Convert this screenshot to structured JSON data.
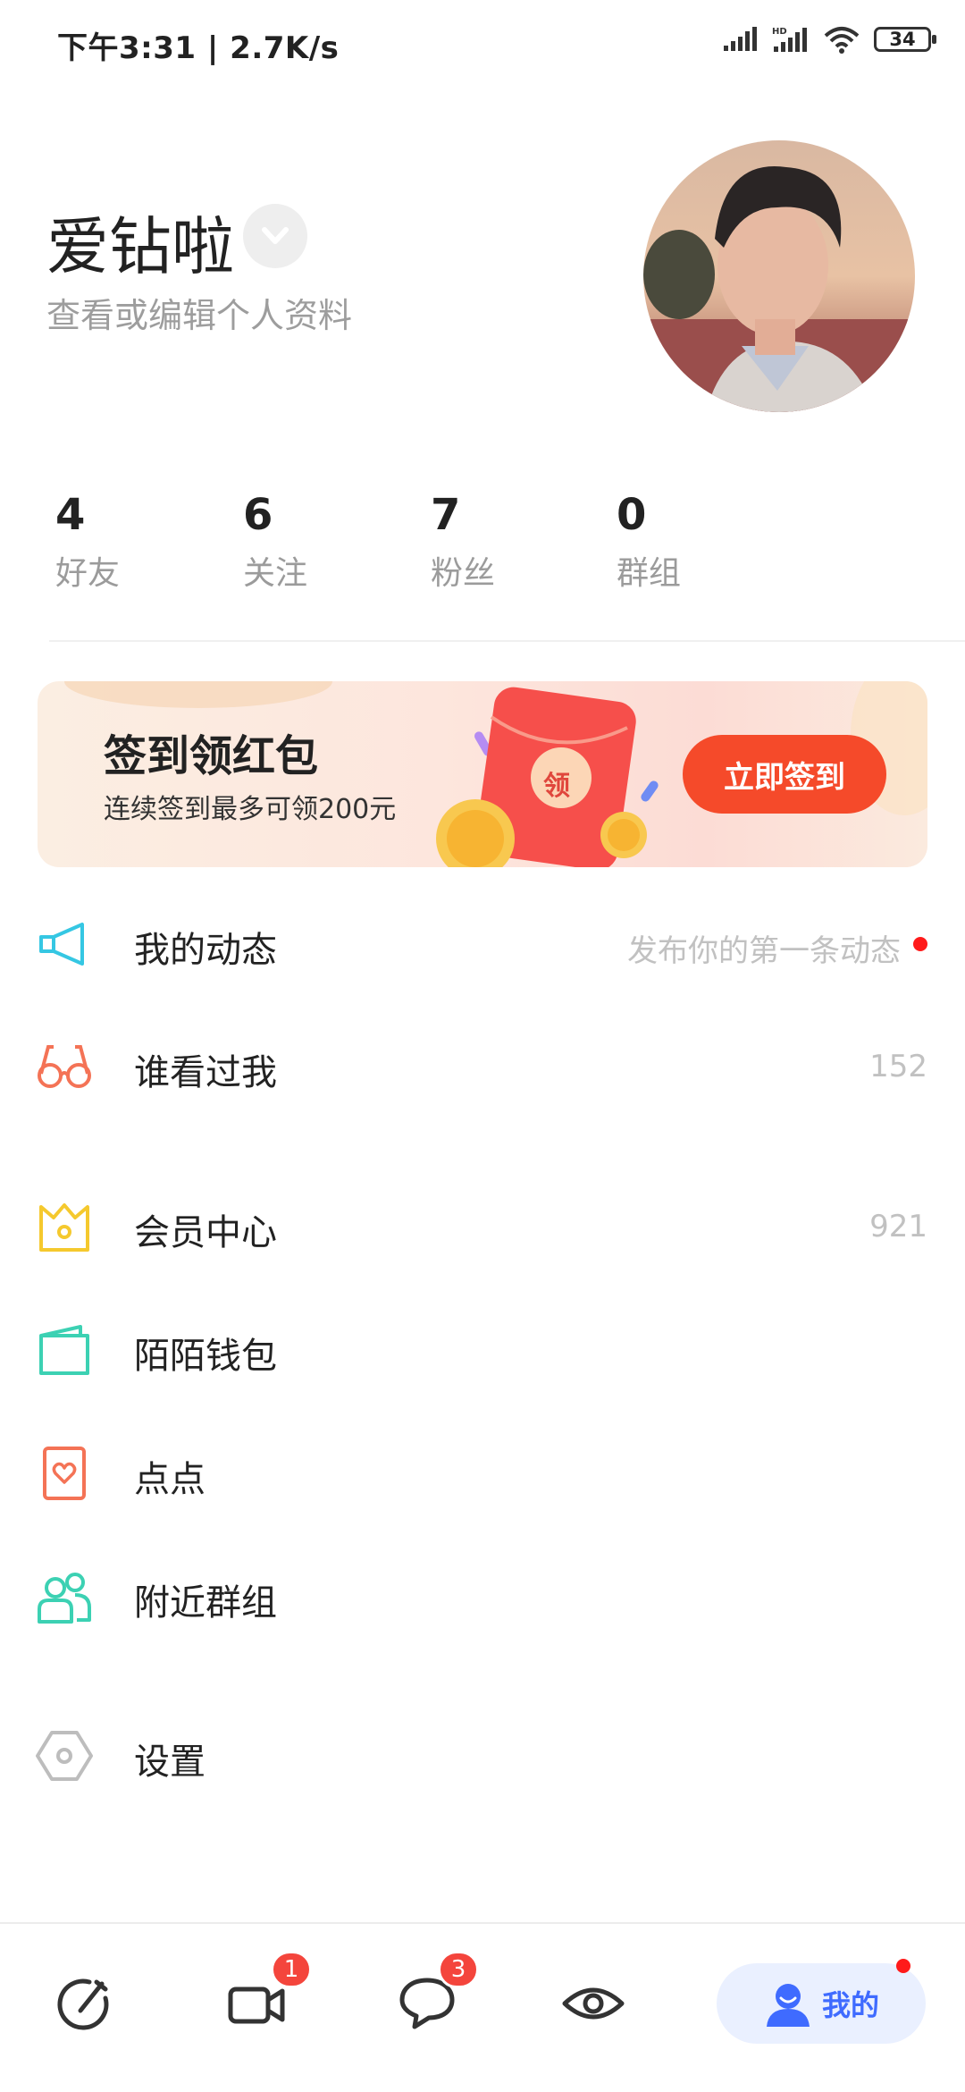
{
  "status_bar": {
    "time": "下午3:31 | 2.7K/s",
    "battery": "34"
  },
  "profile": {
    "name": "爱钻啦",
    "subtitle": "查看或编辑个人资料"
  },
  "stats": [
    {
      "value": "4",
      "label": "好友"
    },
    {
      "value": "6",
      "label": "关注"
    },
    {
      "value": "7",
      "label": "粉丝"
    },
    {
      "value": "0",
      "label": "群组"
    }
  ],
  "banner": {
    "title": "签到领红包",
    "subtitle": "连续签到最多可领200元",
    "button": "立即签到",
    "envelope_text": "领"
  },
  "menu": [
    {
      "label": "我的动态",
      "right": "发布你的第一条动态"
    },
    {
      "label": "谁看过我",
      "right": "152"
    },
    {
      "label": "会员中心",
      "right": "921"
    },
    {
      "label": "陌陌钱包"
    },
    {
      "label": "点点"
    },
    {
      "label": "附近群组"
    },
    {
      "label": "设置"
    }
  ],
  "bottom_nav": {
    "video_badge": "1",
    "chat_badge": "3",
    "mine_label": "我的"
  },
  "colors": {
    "accent": "#3f6bff",
    "banner_button": "#f54a2a",
    "badge": "#f4453c"
  }
}
